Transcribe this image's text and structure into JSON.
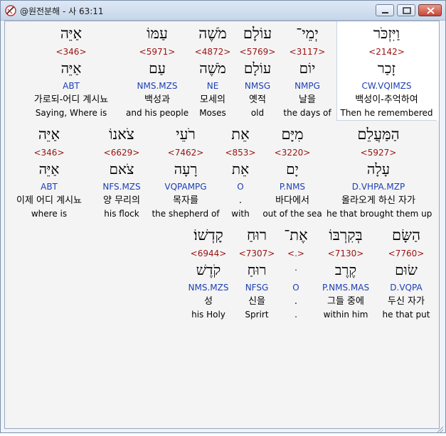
{
  "window": {
    "title": "@원전분해 - 사 63:11",
    "accent": "#c6463a"
  },
  "rows": [
    {
      "words": [
        {
          "heb": "וַיִּזְכֹּר",
          "strong": "<2142>",
          "lemma": "זָכַר",
          "morph": "CW.VQIMZS",
          "kor": "백성이-추억하여",
          "eng": "Then he remembered"
        },
        {
          "heb": "יְמֵי־",
          "strong": "<3117>",
          "lemma": "יוֹם",
          "morph": "NMPG",
          "kor": "날을",
          "eng": "the days of"
        },
        {
          "heb": "עוֹלָם",
          "strong": "<5769>",
          "lemma": "עוֹלָם",
          "morph": "NMSG",
          "kor": "옛적",
          "eng": "old"
        },
        {
          "heb": "מֹשֶׁה",
          "strong": "<4872>",
          "lemma": "מֹשֶׁה",
          "morph": "NE",
          "kor": "모세의",
          "eng": "Moses"
        },
        {
          "heb": "עַמּוֹ",
          "strong": "<5971>",
          "lemma": "עַם",
          "morph": "NMS.MZS",
          "kor": "백성과",
          "eng": "and his people"
        },
        {
          "heb": "אַיֵּה",
          "strong": "<346>",
          "lemma": "אַיֵּה",
          "morph": "ABT",
          "kor": "가로되-어디 계시뇨",
          "eng": "Saying, Where is"
        }
      ]
    },
    {
      "words": [
        {
          "heb": "הַמַּעֲלֵם",
          "strong": "<5927>",
          "lemma": "עָלָה",
          "morph": "D.VHPA.MZP",
          "kor": "올라오게 하신 자가",
          "eng": "he that brought them up"
        },
        {
          "heb": "מִיָּם",
          "strong": "<3220>",
          "lemma": "יָם",
          "morph": "P.NMS",
          "kor": "바다에서",
          "eng": "out of the sea"
        },
        {
          "heb": "אֵת",
          "strong": "<853>",
          "lemma": "אֵת",
          "morph": "O",
          "kor": ".",
          "eng": "with"
        },
        {
          "heb": "רֹעֵי",
          "strong": "<7462>",
          "lemma": "רָעָה",
          "morph": "VQPAMPG",
          "kor": "목자를",
          "eng": "the shepherd of"
        },
        {
          "heb": "צֹאנוֹ",
          "strong": "<6629>",
          "lemma": "צֹאם",
          "morph": "NFS.MZS",
          "kor": "양 무리의",
          "eng": "his flock"
        },
        {
          "heb": "אַיֵּה",
          "strong": "<346>",
          "lemma": "אַיֵּה",
          "morph": "ABT",
          "kor": "이제 어디 계시뇨",
          "eng": "where is"
        }
      ]
    },
    {
      "words": [
        {
          "heb": "הַשָּׂם",
          "strong": "<7760>",
          "lemma": "שׂוּם",
          "morph": "D.VQPA",
          "kor": "두신 자가",
          "eng": "he that put"
        },
        {
          "heb": "בְּקִרְבּוֹ",
          "strong": "<7130>",
          "lemma": "קֶרֶב",
          "morph": "P.NMS.MAS",
          "kor": "그들 중에",
          "eng": "within him"
        },
        {
          "heb": "אֶת־",
          "strong": "<.>",
          "lemma": "ּ",
          "morph": "O",
          "kor": ".",
          "eng": "."
        },
        {
          "heb": "רוּחַ",
          "strong": "<7307>",
          "lemma": "רוּחַ",
          "morph": "NFSG",
          "kor": "신을",
          "eng": "Sprirt"
        },
        {
          "heb": "קָדְשׁוֹ׃",
          "strong": "<6944>",
          "lemma": "קֹדֶשׁ",
          "morph": "NMS.MZS",
          "kor": "성",
          "eng": "his Holy"
        }
      ]
    }
  ]
}
